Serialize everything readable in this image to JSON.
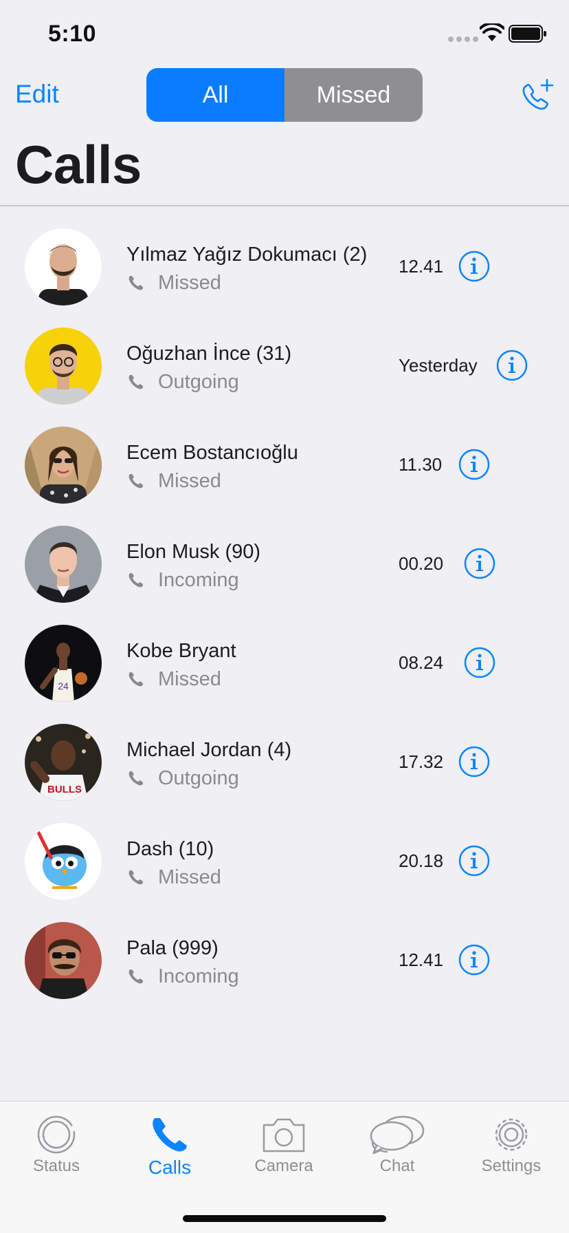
{
  "status_bar": {
    "time": "5:10"
  },
  "header": {
    "edit_label": "Edit",
    "segments": {
      "all": "All",
      "missed": "Missed"
    },
    "selected_segment": "All",
    "title": "Calls"
  },
  "calls": [
    {
      "name": "Yılmaz Yağız Dokumacı (2)",
      "type": "Missed",
      "time": "12.41",
      "avatar": "man-beard-dark-shirt"
    },
    {
      "name": "Oğuzhan İnce (31)",
      "type": "Outgoing",
      "time": "Yesterday",
      "avatar": "man-glasses-yellow-bg"
    },
    {
      "name": "Ecem Bostancıoğlu",
      "type": "Missed",
      "time": "11.30",
      "avatar": "woman-sunglasses"
    },
    {
      "name": "Elon Musk (90)",
      "type": "Incoming",
      "time": "00.20",
      "avatar": "man-suit"
    },
    {
      "name": "Kobe Bryant",
      "type": "Missed",
      "time": "08.24",
      "avatar": "basketball-player-lakers"
    },
    {
      "name": "Michael Jordan (4)",
      "type": "Outgoing",
      "time": "17.32",
      "avatar": "basketball-player-bulls"
    },
    {
      "name": "Dash (10)",
      "type": "Missed",
      "time": "20.18",
      "avatar": "cartoon-bird"
    },
    {
      "name": "Pala (999)",
      "type": "Incoming",
      "time": "12.41",
      "avatar": "man-sunglasses-mustache"
    }
  ],
  "tab_bar": {
    "status": "Status",
    "calls": "Calls",
    "camera": "Camera",
    "chat": "Chat",
    "settings": "Settings",
    "active": "Calls"
  },
  "colors": {
    "accent": "#0a84ff",
    "segment_selected": "#0a7cff",
    "segment_unselected": "#8e8e93",
    "background": "#efeff4"
  }
}
